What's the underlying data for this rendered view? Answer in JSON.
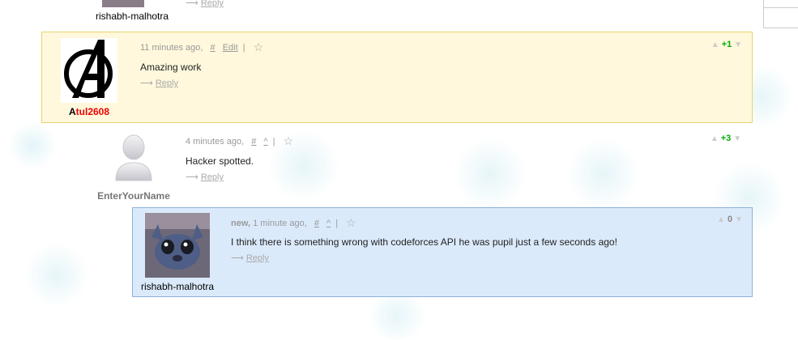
{
  "top_partial": {
    "reply_label": "Reply",
    "author": "rishabh-malhotra"
  },
  "comments": [
    {
      "author_first": "A",
      "author_rest": "tul2608",
      "time": "11 minutes ago,",
      "hash": "#",
      "edit": "Edit",
      "pipe": "|",
      "text": "Amazing work",
      "reply_arrow": "⟶",
      "reply_label": "Reply",
      "vote_up": "▲",
      "vote_down": "▼",
      "votes": "+1"
    },
    {
      "author": "EnterYourName",
      "time": "4 minutes ago,",
      "hash": "#",
      "parent": "^",
      "pipe": "|",
      "text": "Hacker spotted.",
      "reply_arrow": "⟶",
      "reply_label": "Reply",
      "vote_up": "▲",
      "vote_down": "▼",
      "votes": "+3"
    },
    {
      "author": "rishabh-malhotra",
      "new_badge": "new,",
      "time": "1 minute ago,",
      "hash": "#",
      "parent": "^",
      "pipe": "|",
      "text": "I think there is something wrong with codeforces API he was pupil just a few seconds ago!",
      "reply_arrow": "⟶",
      "reply_label": "Reply",
      "vote_up": "▲",
      "vote_down": "▼",
      "votes": "0"
    }
  ],
  "icons": {
    "star": "star-outline-icon",
    "up": "vote-up-icon",
    "down": "vote-down-icon"
  },
  "colors": {
    "own_bg": "#fff8dc",
    "new_bg": "#dbeafb",
    "positive": "#00aa00",
    "red_handle": "#ee0000"
  }
}
